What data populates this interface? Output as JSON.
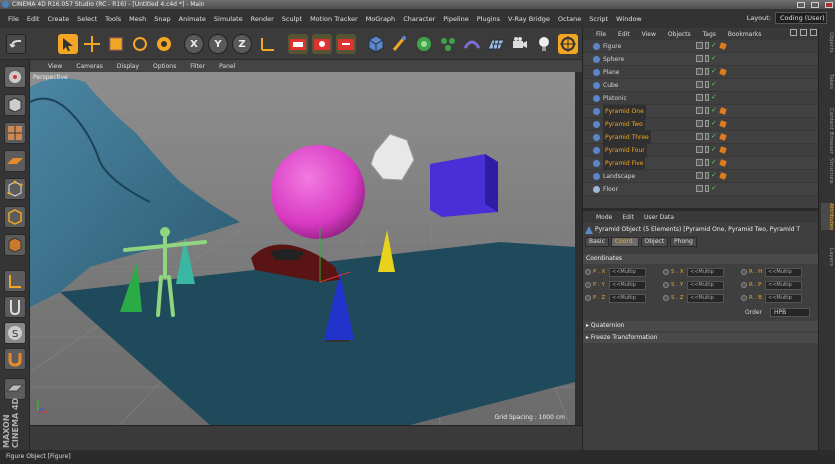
{
  "title": "CINEMA 4D R16.057 Studio (RC - R16) - [Untitled 4.c4d *] - Main",
  "menubar": {
    "items": [
      "File",
      "Edit",
      "Create",
      "Select",
      "Tools",
      "Mesh",
      "Snap",
      "Animate",
      "Simulate",
      "Render",
      "Sculpt",
      "Motion Tracker",
      "MoGraph",
      "Character",
      "Pipeline",
      "Plugins",
      "V-Ray Bridge",
      "Octane",
      "Script",
      "Window"
    ],
    "layout_label": "Layout:",
    "layout_value": "Coding (User)"
  },
  "toolbar": {
    "x_label": "X",
    "y_label": "Y",
    "z_label": "Z"
  },
  "viewport": {
    "menu": [
      "View",
      "Cameras",
      "Display",
      "Options",
      "Filter",
      "Panel"
    ],
    "label": "Perspective",
    "grid_spacing": "Grid Spacing : 1000 cm"
  },
  "object_manager": {
    "menu": [
      "File",
      "Edit",
      "View",
      "Objects",
      "Tags",
      "Bookmarks"
    ],
    "objects": [
      {
        "name": "Figure",
        "selected": false,
        "icon_color": "#5b86c9",
        "tag": true
      },
      {
        "name": "Sphere",
        "selected": false,
        "icon_color": "#5b86c9",
        "tag": false
      },
      {
        "name": "Plane",
        "selected": false,
        "icon_color": "#5b86c9",
        "tag": true
      },
      {
        "name": "Cube",
        "selected": false,
        "icon_color": "#5b86c9",
        "tag": false
      },
      {
        "name": "Platonic",
        "selected": false,
        "icon_color": "#5b86c9",
        "tag": false
      },
      {
        "name": "Pyramid One",
        "selected": true,
        "icon_color": "#5b86c9",
        "tag": true
      },
      {
        "name": "Pyramid Two",
        "selected": true,
        "icon_color": "#5b86c9",
        "tag": true
      },
      {
        "name": "Pyramid Three",
        "selected": true,
        "icon_color": "#5b86c9",
        "tag": true
      },
      {
        "name": "Pyramid Four",
        "selected": true,
        "icon_color": "#5b86c9",
        "tag": true
      },
      {
        "name": "Pyramid Five",
        "selected": true,
        "icon_color": "#5b86c9",
        "tag": true
      },
      {
        "name": "Landscape",
        "selected": false,
        "icon_color": "#5b86c9",
        "tag": true
      },
      {
        "name": "Floor",
        "selected": false,
        "icon_color": "#9fb7d9",
        "tag": false
      }
    ]
  },
  "attribute_manager": {
    "menu": [
      "Mode",
      "Edit",
      "User Data"
    ],
    "header": "Pyramid Object (5 Elements) [Pyramid One, Pyramid Two, Pyramid T",
    "tabs": [
      {
        "label": "Basic",
        "active": false
      },
      {
        "label": "Coord.",
        "active": true
      },
      {
        "label": "Object",
        "active": false
      },
      {
        "label": "Phong",
        "active": false
      }
    ],
    "section_coordinates": "Coordinates",
    "coords": [
      [
        {
          "label": "P . X",
          "value": "<<Multip"
        },
        {
          "label": "S . X",
          "value": "<<Multip"
        },
        {
          "label": "R . H",
          "value": "<<Multip"
        }
      ],
      [
        {
          "label": "P . Y",
          "value": "<<Multip"
        },
        {
          "label": "S . Y",
          "value": "<<Multip"
        },
        {
          "label": "R . P",
          "value": "<<Multip"
        }
      ],
      [
        {
          "label": "P . Z",
          "value": "<<Multip"
        },
        {
          "label": "S . Z",
          "value": "<<Multip"
        },
        {
          "label": "R . B",
          "value": "<<Multip"
        }
      ]
    ],
    "order_label": "Order",
    "order_value": "HPB",
    "section_quaternion": "Quaternion",
    "section_freeze": "Freeze Transformation"
  },
  "side_tabs": [
    "Objects",
    "Takes",
    "Content Browser",
    "Structure",
    "Attributes",
    "Layers"
  ],
  "status": "Figure Object [Figure]",
  "maxon_label": "MAXON CINEMA 4D",
  "colors": {
    "accent": "#f2a623",
    "sphere": "#e23fc9",
    "cube": "#4a2fd6",
    "water": "#1f4a5c",
    "landscape": "#3b6c84"
  }
}
